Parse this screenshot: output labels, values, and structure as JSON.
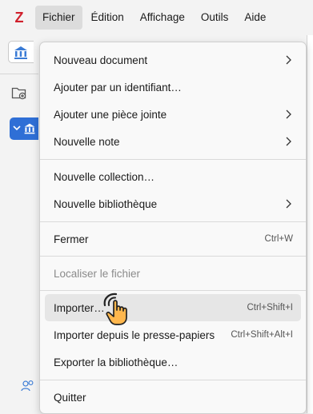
{
  "menubar": {
    "logo": "Z",
    "items": [
      {
        "label": "Fichier"
      },
      {
        "label": "Édition"
      },
      {
        "label": "Affichage"
      },
      {
        "label": "Outils"
      },
      {
        "label": "Aide"
      }
    ]
  },
  "file_menu": {
    "items": [
      {
        "label": "Nouveau document",
        "submenu": true
      },
      {
        "label": "Ajouter par un identifiant…"
      },
      {
        "label": "Ajouter une pièce jointe",
        "submenu": true
      },
      {
        "label": "Nouvelle note",
        "submenu": true
      },
      {
        "label": "Nouvelle collection…"
      },
      {
        "label": "Nouvelle bibliothèque",
        "submenu": true
      },
      {
        "label": "Fermer",
        "shortcut": "Ctrl+W"
      },
      {
        "label": "Localiser le fichier",
        "disabled": true
      },
      {
        "label": "Importer…",
        "shortcut": "Ctrl+Shift+I",
        "highlighted": true
      },
      {
        "label": "Importer depuis le presse-papiers",
        "shortcut": "Ctrl+Shift+Alt+I"
      },
      {
        "label": "Exporter la bibliothèque…"
      },
      {
        "label": "Quitter"
      }
    ]
  },
  "colors": {
    "logo": "#d0202c",
    "selection": "#2f6fd6",
    "library_icon": "#3a7bd5",
    "cursor_fill": "#ffb74d"
  }
}
